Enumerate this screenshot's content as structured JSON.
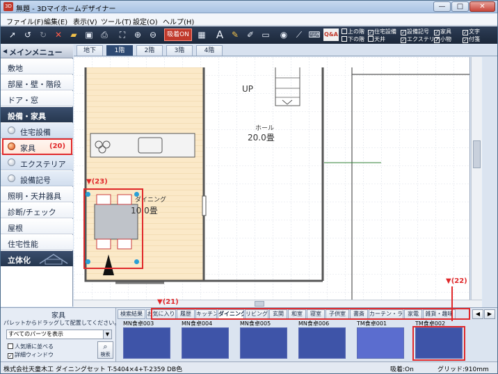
{
  "window": {
    "title": "無題 - 3Dマイホームデザイナー",
    "app_icon": "3D",
    "minimize": "—",
    "maximize": "□",
    "close": "✕"
  },
  "menu": [
    "ファイル(F)",
    "編集(E)",
    "表示(V)",
    "ツール(T)",
    "設定(O)",
    "ヘルプ(H)"
  ],
  "toolbar": {
    "magnet_label": "吸着ON",
    "text_tool": "A",
    "qa_label": "Q&A",
    "display_checks": [
      {
        "label": "上の階",
        "checked": false
      },
      {
        "label": "下の階",
        "checked": false
      },
      {
        "label": "住宅設備",
        "checked": true
      },
      {
        "label": "天井",
        "checked": false
      },
      {
        "label": "設備記号",
        "checked": true
      },
      {
        "label": "エクステリア",
        "checked": true
      },
      {
        "label": "家具",
        "checked": true
      },
      {
        "label": "小物",
        "checked": true
      },
      {
        "label": "文字",
        "checked": true
      },
      {
        "label": "付箋",
        "checked": true
      }
    ]
  },
  "sidebar": {
    "main_menu_label": "メインメニュー",
    "items": [
      "敷地",
      "部屋・壁・階段",
      "ドア・窓"
    ],
    "section_equipment": "設備・家具",
    "sub_items": [
      "住宅設備",
      "家具",
      "エクステリア",
      "設備記号"
    ],
    "items2": [
      "照明・天井器具",
      "診断/チェック",
      "屋根",
      "住宅性能"
    ],
    "section_3d": "立体化"
  },
  "floor_tabs": [
    "地下",
    "1階",
    "2階",
    "3階",
    "4階"
  ],
  "canvas": {
    "up_label": "UP",
    "hall_name": "ホール",
    "hall_size": "20.0畳",
    "dining_name": "ダイニング",
    "dining_size": "10.0畳"
  },
  "parts_panel": {
    "title": "家具",
    "hint": "パレットからドラッグして配置してください。",
    "filter": "すべてのパーツを表示",
    "check_popular": {
      "label": "人気順に並べる",
      "checked": false
    },
    "check_detail": {
      "label": "詳細ウィンドウ",
      "checked": true
    },
    "search_label": "検索",
    "categories": [
      "検索結果",
      "お気に入り",
      "履歴",
      "キッチン",
      "ダイニング",
      "リビング",
      "玄関",
      "和室",
      "寝室",
      "子供室",
      "書斎",
      "カーテン・ラグ",
      "家電",
      "雑貨・趣味"
    ],
    "active_category": "ダイニング",
    "thumbnails": [
      "MN食卓003",
      "MN食卓004",
      "MN食卓005",
      "MN食卓006",
      "TM食卓001",
      "TM食卓002"
    ],
    "nav_prev": "◀",
    "nav_next": "▶"
  },
  "status": {
    "text": "株式会社天童木工 ダイニングセット T-5404×4+T-2359 DB色",
    "snap": "吸着:On",
    "grid": "グリッド:910mm"
  },
  "annotations": {
    "c20": "(20)",
    "c21": "▼(21)",
    "c22": "▼(22)",
    "c23": "▼(23)"
  },
  "colors": {
    "highlight": "#e0282a",
    "toolbar_bg": "#1b2739",
    "floor_wood": "#fbe9c8"
  }
}
